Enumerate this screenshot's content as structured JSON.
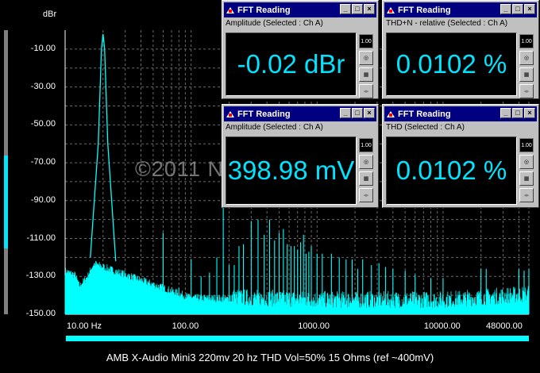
{
  "chart_data": {
    "type": "line",
    "title": "AMB X-Audio Mini3 220mv 20 hz THD Vol=50% 15 Ohms (ref ~400mV)",
    "ylabel": "dBr",
    "xlabel": "",
    "x_scale": "log",
    "xlim": [
      10,
      48000
    ],
    "ylim": [
      -150,
      0
    ],
    "y_ticks": [
      "-10.00",
      "-30.00",
      "-50.00",
      "-70.00",
      "-90.00",
      "-110.00",
      "-130.00",
      "-150.00"
    ],
    "x_ticks": [
      "10.00 Hz",
      "100.00",
      "1000.00",
      "10000.00",
      "48000.00"
    ],
    "grid": true,
    "series": [
      {
        "color": "#00ffff",
        "fundamental": {
          "x": 20,
          "y": -2
        },
        "harmonics": [
          {
            "x": 40,
            "y": -132
          },
          {
            "x": 60,
            "y": -107
          },
          {
            "x": 80,
            "y": -136
          },
          {
            "x": 100,
            "y": -121
          },
          {
            "x": 120,
            "y": -130
          },
          {
            "x": 140,
            "y": -128
          },
          {
            "x": 160,
            "y": -120
          },
          {
            "x": 180,
            "y": -86
          },
          {
            "x": 200,
            "y": -124
          },
          {
            "x": 220,
            "y": -124
          },
          {
            "x": 240,
            "y": -114
          },
          {
            "x": 260,
            "y": -113
          },
          {
            "x": 300,
            "y": -101
          },
          {
            "x": 340,
            "y": -100
          },
          {
            "x": 380,
            "y": -108
          },
          {
            "x": 420,
            "y": -100
          },
          {
            "x": 460,
            "y": -111
          },
          {
            "x": 500,
            "y": -107
          },
          {
            "x": 540,
            "y": -105
          },
          {
            "x": 580,
            "y": -113
          },
          {
            "x": 620,
            "y": -114
          },
          {
            "x": 660,
            "y": -114
          },
          {
            "x": 700,
            "y": -116
          },
          {
            "x": 740,
            "y": -112
          },
          {
            "x": 780,
            "y": -108
          },
          {
            "x": 820,
            "y": -118
          },
          {
            "x": 860,
            "y": -117
          },
          {
            "x": 900,
            "y": -114
          },
          {
            "x": 1000,
            "y": -118
          },
          {
            "x": 1100,
            "y": -118
          },
          {
            "x": 1300,
            "y": -118
          },
          {
            "x": 1500,
            "y": -120
          },
          {
            "x": 1700,
            "y": -121
          },
          {
            "x": 1900,
            "y": -121
          },
          {
            "x": 2100,
            "y": -126
          },
          {
            "x": 2300,
            "y": -121
          },
          {
            "x": 2700,
            "y": -124
          },
          {
            "x": 3100,
            "y": -123
          },
          {
            "x": 3500,
            "y": -125
          },
          {
            "x": 4000,
            "y": -126
          },
          {
            "x": 5000,
            "y": -127
          },
          {
            "x": 6000,
            "y": -129
          },
          {
            "x": 8000,
            "y": -131
          },
          {
            "x": 10000,
            "y": -131
          },
          {
            "x": 20000,
            "y": -126
          },
          {
            "x": 22000,
            "y": -126
          },
          {
            "x": 40000,
            "y": -126
          },
          {
            "x": 44000,
            "y": -127
          },
          {
            "x": 48000,
            "y": -126
          }
        ],
        "noise_floor": [
          {
            "x": 10,
            "y": -128
          },
          {
            "x": 12,
            "y": -130
          },
          {
            "x": 13,
            "y": -136
          },
          {
            "x": 15,
            "y": -131
          },
          {
            "x": 17,
            "y": -124
          },
          {
            "x": 100,
            "y": -142
          },
          {
            "x": 1000,
            "y": -144
          },
          {
            "x": 10000,
            "y": -144
          },
          {
            "x": 48000,
            "y": -141
          }
        ]
      }
    ]
  },
  "caption": "AMB X-Audio Mini3 220mv 20 hz THD Vol=50% 15 Ohms (ref ~400mV)",
  "watermark": "©2011 NwAvGuy.com",
  "windows": [
    {
      "title": "FFT Reading",
      "label": "Amplitude (Selected : Ch A)",
      "value": "-0.02 dBr"
    },
    {
      "title": "FFT Reading",
      "label": "THD+N - relative (Selected : Ch A)",
      "value": "0.0102 %"
    },
    {
      "title": "FFT Reading",
      "label": "Amplitude (Selected : Ch A)",
      "value": "398.98 mV"
    },
    {
      "title": "FFT Reading",
      "label": "THD (Selected : Ch A)",
      "value": "0.0102 %"
    }
  ],
  "window_buttons": {
    "minimize": "_",
    "maximize": "□",
    "close": "×"
  },
  "side_buttons": {
    "display": "1.00",
    "gauge": "◎",
    "table": "▦",
    "arrows": "◂▸"
  }
}
